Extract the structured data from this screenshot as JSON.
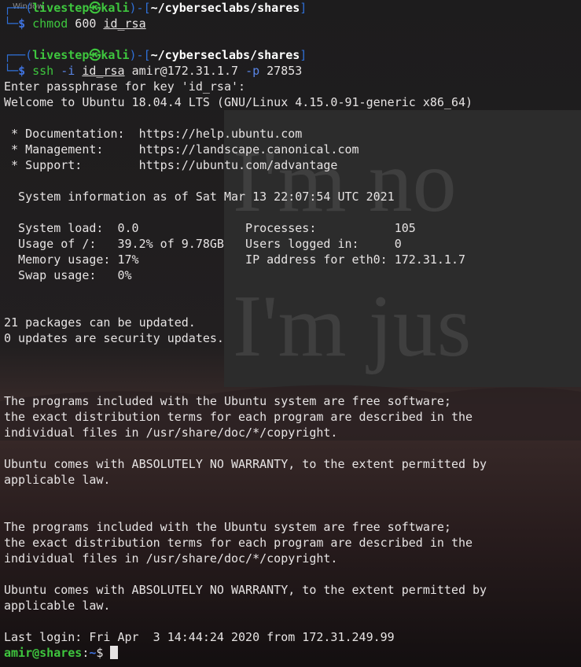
{
  "window_label": "Window",
  "wallpaper": {
    "text_line1": "I'm no",
    "text_line2": "I'm jus"
  },
  "prompt1": {
    "user": "livestep",
    "skull": "㉿",
    "host": "kali",
    "path": "~/cyberseclabs/shares",
    "cmd": "chmod",
    "args": " 600 ",
    "file": "id_rsa"
  },
  "prompt2": {
    "user": "livestep",
    "skull": "㉿",
    "host": "kali",
    "path": "~/cyberseclabs/shares",
    "cmd": "ssh",
    "flag_i": "-i",
    "file": "id_rsa",
    "target": "amir@172.31.1.7",
    "flag_p": "-p",
    "port": "27853"
  },
  "output": [
    "Enter passphrase for key 'id_rsa':",
    "Welcome to Ubuntu 18.04.4 LTS (GNU/Linux 4.15.0-91-generic x86_64)",
    "",
    " * Documentation:  https://help.ubuntu.com",
    " * Management:     https://landscape.canonical.com",
    " * Support:        https://ubuntu.com/advantage",
    "",
    "  System information as of Sat Mar 13 22:07:54 UTC 2021",
    "",
    "  System load:  0.0               Processes:           105",
    "  Usage of /:   39.2% of 9.78GB   Users logged in:     0",
    "  Memory usage: 17%               IP address for eth0: 172.31.1.7",
    "  Swap usage:   0%",
    "",
    "",
    "21 packages can be updated.",
    "0 updates are security updates.",
    "",
    "",
    "",
    "The programs included with the Ubuntu system are free software;",
    "the exact distribution terms for each program are described in the",
    "individual files in /usr/share/doc/*/copyright.",
    "",
    "Ubuntu comes with ABSOLUTELY NO WARRANTY, to the extent permitted by",
    "applicable law.",
    "",
    "",
    "The programs included with the Ubuntu system are free software;",
    "the exact distribution terms for each program are described in the",
    "individual files in /usr/share/doc/*/copyright.",
    "",
    "Ubuntu comes with ABSOLUTELY NO WARRANTY, to the extent permitted by",
    "applicable law.",
    "",
    "Last login: Fri Apr  3 14:44:24 2020 from 172.31.249.99"
  ],
  "final_prompt": {
    "user_host": "amir@shares",
    "sep": ":",
    "path": "~",
    "symbol": "$ "
  }
}
